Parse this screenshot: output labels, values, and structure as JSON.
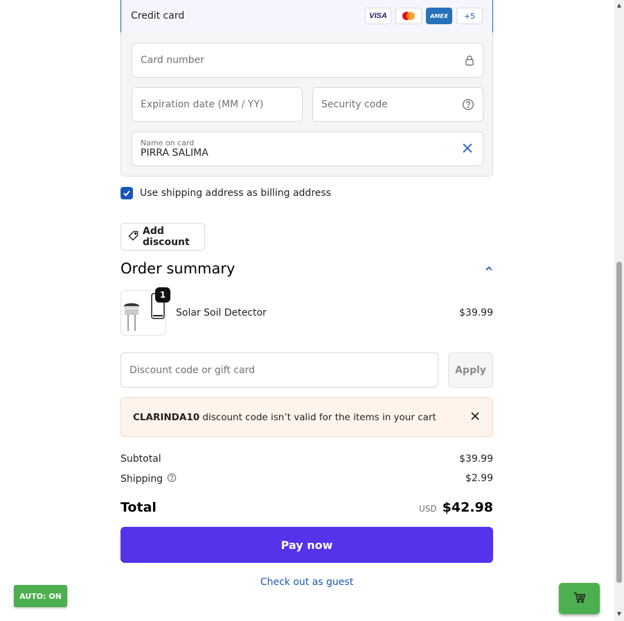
{
  "payment": {
    "method_label": "Credit card",
    "card_logos": [
      "VISA",
      "Mastercard",
      "AMEX"
    ],
    "more_logos": "+5",
    "card_number_placeholder": "Card number",
    "expiration_placeholder": "Expiration date (MM / YY)",
    "security_code_placeholder": "Security code",
    "name_label": "Name on card",
    "name_value": "PIRRA SALIMA",
    "billing_checkbox_label": "Use shipping address as billing address",
    "billing_checked": true
  },
  "discount_button": {
    "label": "Add discount"
  },
  "summary": {
    "title": "Order summary",
    "item": {
      "name": "Solar Soil Detector",
      "price": "$39.99",
      "quantity": "1"
    },
    "discount_placeholder": "Discount code or gift card",
    "apply_label": "Apply",
    "error": {
      "code": "CLARINDA10",
      "message": " discount code isn’t valid for the items in your cart"
    },
    "subtotal_label": "Subtotal",
    "subtotal_value": "$39.99",
    "shipping_label": "Shipping",
    "shipping_value": "$2.99",
    "total_label": "Total",
    "currency": "USD",
    "total_value": "$42.98"
  },
  "actions": {
    "pay_label": "Pay now",
    "guest_label": "Check out as guest"
  },
  "overlay": {
    "auto_label": "AUTO: ON"
  },
  "colors": {
    "accent": "#1a56b8",
    "pay_button": "#5433eb",
    "error_bg": "#fff4ec",
    "badge_green": "#4caf50"
  }
}
